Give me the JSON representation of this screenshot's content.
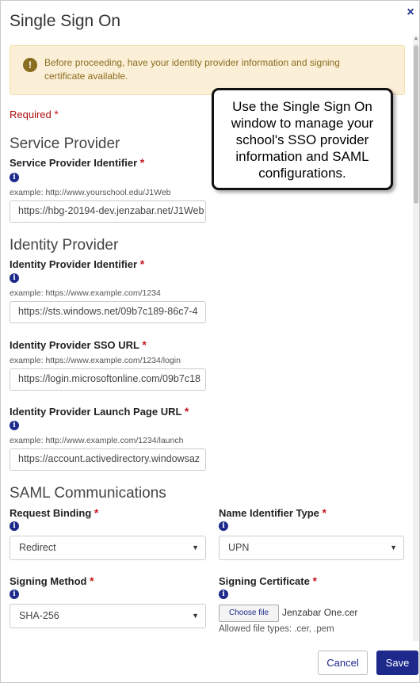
{
  "dialog": {
    "title": "Single Sign On",
    "close_icon": "close-icon"
  },
  "alert": {
    "icon": "warning-icon",
    "message": "Before proceeding, have your identity provider information and signing certificate available."
  },
  "required_label": "Required",
  "required_star": "*",
  "service_provider": {
    "heading": "Service Provider",
    "identifier_label": "Service Provider Identifier",
    "identifier_example": "example: http://www.yourschool.edu/J1Web",
    "identifier_value": "https://hbg-20194-dev.jenzabar.net/J1Web"
  },
  "identity_provider": {
    "heading": "Identity Provider",
    "identifier_label": "Identity Provider Identifier",
    "identifier_example": "example: https://www.example.com/1234",
    "identifier_value": "https://sts.windows.net/09b7c189-86c7-4",
    "sso_url_label": "Identity Provider SSO URL",
    "sso_url_example": "example: https://www.example.com/1234/login",
    "sso_url_value": "https://login.microsoftonline.com/09b7c18",
    "launch_label": "Identity Provider Launch Page URL",
    "launch_example": "example: http://www.example.com/1234/launch",
    "launch_value": "https://account.activedirectory.windowsaz"
  },
  "saml": {
    "heading": "SAML Communications",
    "request_binding_label": "Request Binding",
    "request_binding_value": "Redirect",
    "name_id_label": "Name Identifier Type",
    "name_id_value": "UPN",
    "signing_method_label": "Signing Method",
    "signing_method_value": "SHA-256",
    "signing_cert_label": "Signing Certificate",
    "choose_file_label": "Choose file",
    "file_name": "Jenzabar One.cer",
    "file_types": "Allowed file types: .cer, .pem"
  },
  "footer": {
    "cancel_label": "Cancel",
    "save_label": "Save"
  },
  "callout": {
    "text": "Use the Single Sign On window to manage your school's SSO provider information and SAML configurations."
  },
  "colors": {
    "primary": "#1d2a8c",
    "required": "#c4161c",
    "alert_bg": "#fcefd7",
    "alert_text": "#8a6d1f"
  }
}
